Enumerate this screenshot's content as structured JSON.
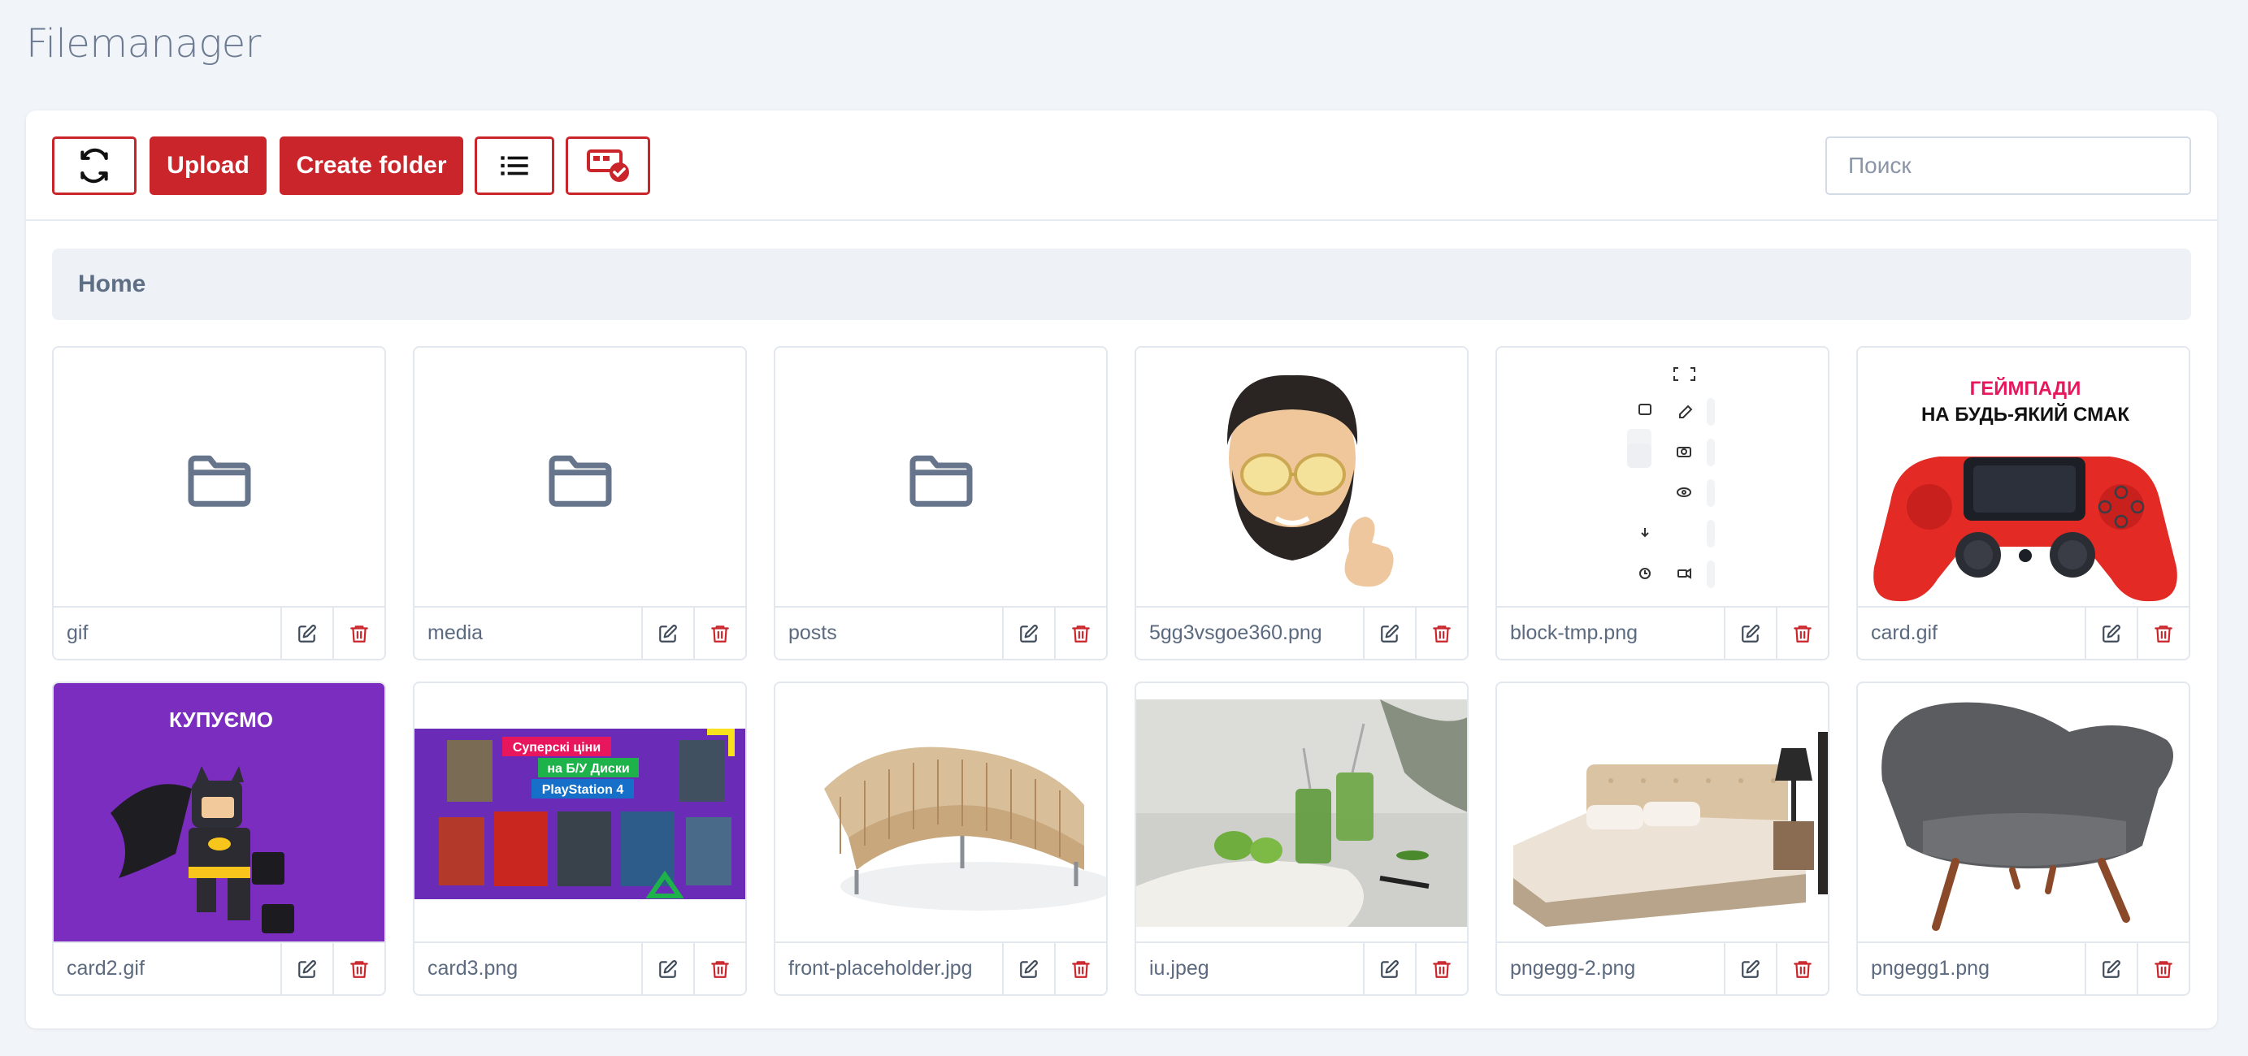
{
  "page": {
    "title": "Filemanager"
  },
  "toolbar": {
    "refresh_icon": "refresh-icon",
    "upload_label": "Upload",
    "create_folder_label": "Create folder",
    "list_view_icon": "list-icon",
    "select_icon": "select-check-icon",
    "search_placeholder": "Поиск",
    "accent_color": "#c9252b"
  },
  "breadcrumb": {
    "items": [
      "Home"
    ]
  },
  "files": [
    {
      "name": "gif",
      "type": "folder"
    },
    {
      "name": "media",
      "type": "folder"
    },
    {
      "name": "posts",
      "type": "folder"
    },
    {
      "name": "5gg3vsgoe360.png",
      "type": "image",
      "preview": "memoji-bearded-man-thumbs-up"
    },
    {
      "name": "block-tmp.png",
      "type": "image",
      "preview": "toolbar-icons"
    },
    {
      "name": "card.gif",
      "type": "image",
      "preview": "red-gamepad",
      "text": [
        "ГЕЙМПАДИ",
        "НА БУДЬ-ЯКИЙ СМАК"
      ]
    },
    {
      "name": "card2.gif",
      "type": "image",
      "preview": "lego-batman",
      "text": [
        "КУПУЄМО"
      ]
    },
    {
      "name": "card3.png",
      "type": "image",
      "preview": "ps4-games",
      "text": [
        "Суперскі ціни",
        "на Б/У Диски",
        "PlayStation 4"
      ]
    },
    {
      "name": "front-placeholder.jpg",
      "type": "image",
      "preview": "wooden-bench"
    },
    {
      "name": "iu.jpeg",
      "type": "image",
      "preview": "green-smoothie"
    },
    {
      "name": "pngegg-2.png",
      "type": "image",
      "preview": "bed"
    },
    {
      "name": "pngegg1.png",
      "type": "image",
      "preview": "grey-armchair"
    }
  ],
  "card_actions": {
    "edit_icon": "edit-icon",
    "delete_icon": "trash-icon"
  }
}
